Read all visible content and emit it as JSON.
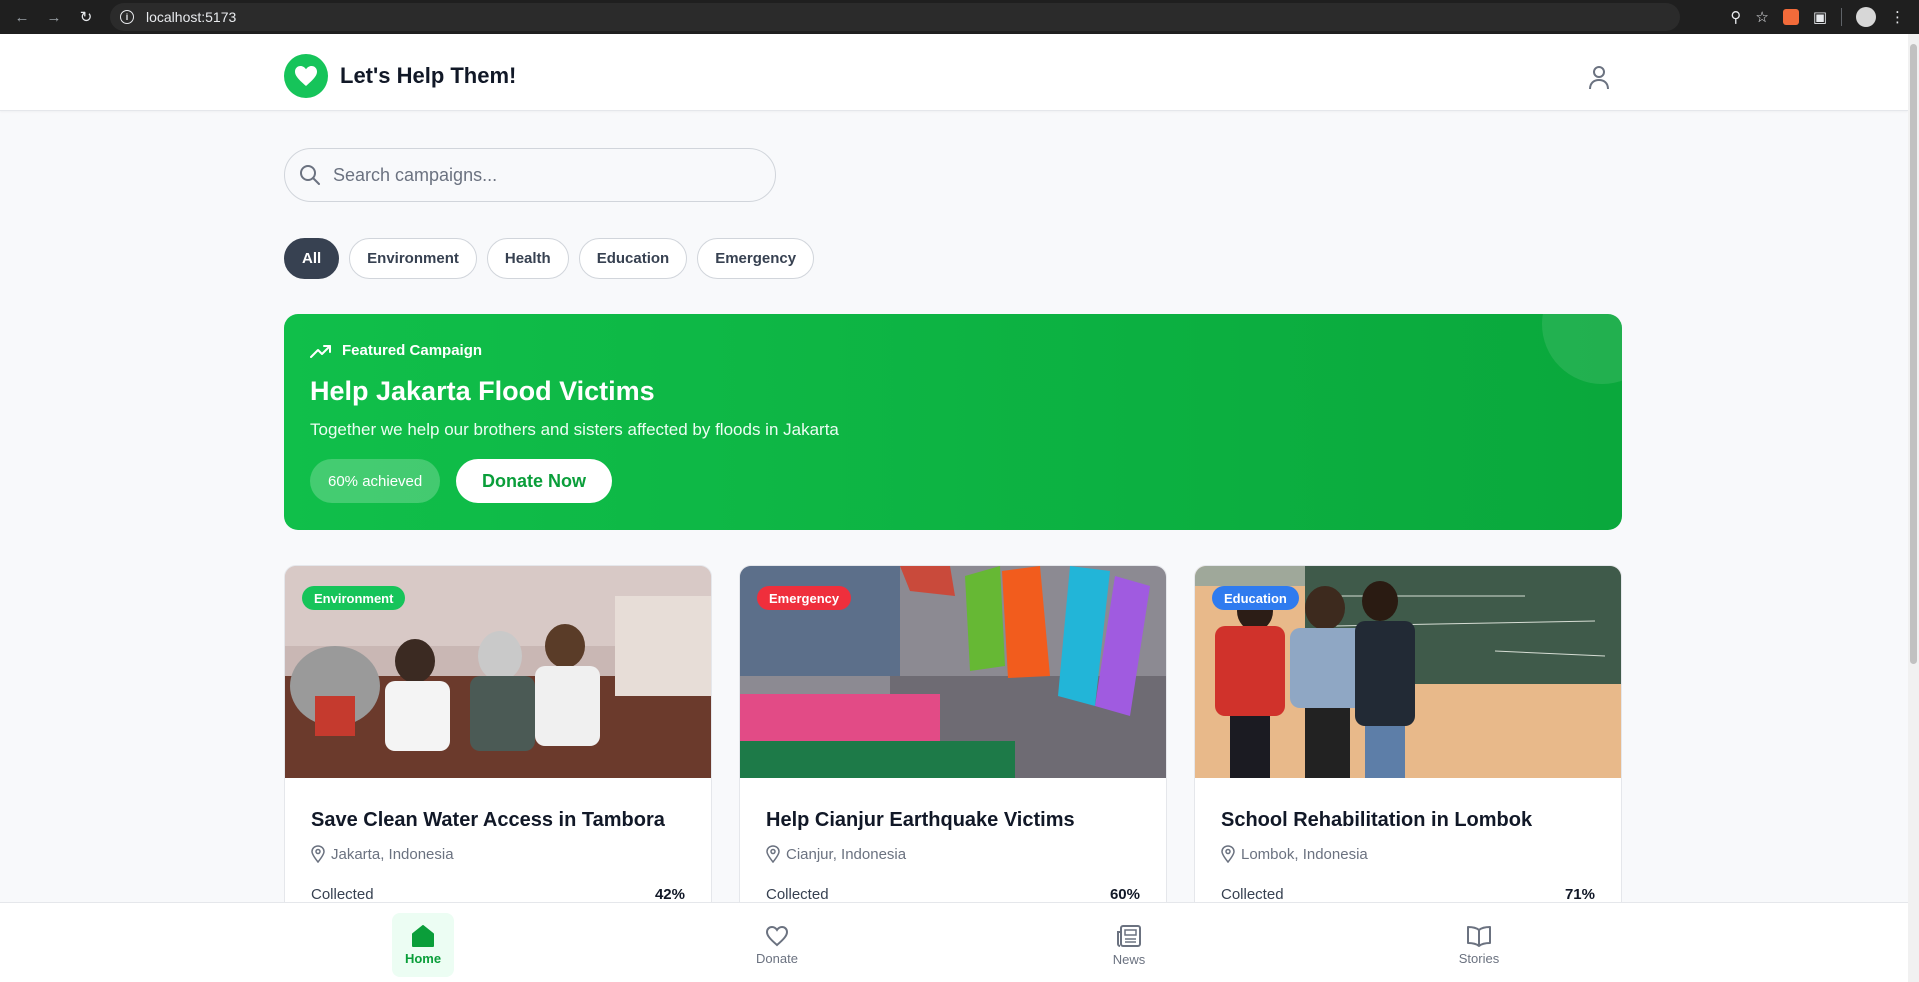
{
  "browser": {
    "url": "localhost:5173"
  },
  "header": {
    "brand_title": "Let's Help Them!"
  },
  "search": {
    "placeholder": "Search campaigns..."
  },
  "filters": [
    {
      "label": "All",
      "active": true
    },
    {
      "label": "Environment",
      "active": false
    },
    {
      "label": "Health",
      "active": false
    },
    {
      "label": "Education",
      "active": false
    },
    {
      "label": "Emergency",
      "active": false
    }
  ],
  "featured": {
    "label": "Featured Campaign",
    "title": "Help Jakarta Flood Victims",
    "description": "Together we help our brothers and sisters affected by floods in Jakarta",
    "progress_text": "60% achieved",
    "progress": 0.6,
    "donate_label": "Donate Now"
  },
  "campaigns": [
    {
      "category": "Environment",
      "category_color": "#16c45a",
      "title": "Save Clean Water Access in Tambora",
      "location": "Jakarta, Indonesia",
      "collected_label": "Collected",
      "percent": "42%"
    },
    {
      "category": "Emergency",
      "category_color": "#ef2f3c",
      "title": "Help Cianjur Earthquake Victims",
      "location": "Cianjur, Indonesia",
      "collected_label": "Collected",
      "percent": "60%"
    },
    {
      "category": "Education",
      "category_color": "#2f7bef",
      "title": "School Rehabilitation in Lombok",
      "location": "Lombok, Indonesia",
      "collected_label": "Collected",
      "percent": "71%"
    }
  ],
  "bottom_nav": [
    {
      "label": "Home",
      "icon": "home-icon",
      "active": true
    },
    {
      "label": "Donate",
      "icon": "heart-icon",
      "active": false
    },
    {
      "label": "News",
      "icon": "newspaper-icon",
      "active": false
    },
    {
      "label": "Stories",
      "icon": "book-open-icon",
      "active": false
    }
  ],
  "colors": {
    "brand": "#16c45a",
    "featured_start": "#10bf4a",
    "featured_end": "#0aa83c",
    "chip_active": "#374151"
  }
}
